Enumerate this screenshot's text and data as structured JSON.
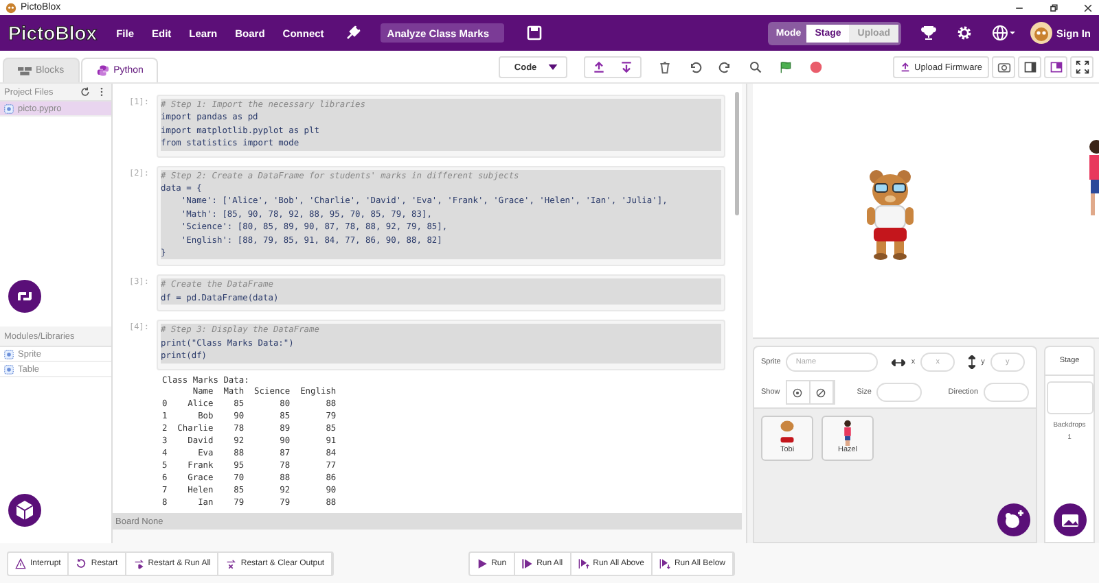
{
  "window": {
    "title": "PictoBlox"
  },
  "menubar": {
    "logo": "PictoBlox",
    "menus": [
      "File",
      "Edit",
      "Learn",
      "Board",
      "Connect"
    ],
    "project_name": "Analyze Class Marks",
    "mode_label": "Mode",
    "modes": [
      {
        "label": "Stage",
        "selected": true
      },
      {
        "label": "Upload",
        "selected": false
      }
    ],
    "sign_in": "Sign In"
  },
  "editor_tabs": [
    {
      "label": "Blocks",
      "kind": "blocks",
      "selected": false
    },
    {
      "label": "Python",
      "kind": "python",
      "selected": true
    }
  ],
  "toolbar": {
    "code_dropdown": "Code",
    "upload_firmware": "Upload Firmware"
  },
  "project_files": {
    "title": "Project Files",
    "files": [
      {
        "name": "picto.pypro",
        "selected": true
      }
    ]
  },
  "modules": {
    "title": "Modules/Libraries",
    "items": [
      "Sprite",
      "Table"
    ]
  },
  "cells": [
    {
      "prompt": "[1]:",
      "lines": [
        {
          "kind": "comment",
          "text": "# Step 1: Import the necessary libraries"
        },
        {
          "kind": "code",
          "text": "import pandas as pd"
        },
        {
          "kind": "code",
          "text": "import matplotlib.pyplot as plt"
        },
        {
          "kind": "code",
          "text": "from statistics import mode"
        }
      ]
    },
    {
      "prompt": "[2]:",
      "lines": [
        {
          "kind": "comment",
          "text": "# Step 2: Create a DataFrame for students' marks in different subjects"
        },
        {
          "kind": "code",
          "text": "data = {"
        },
        {
          "kind": "code",
          "text": "    'Name': ['Alice', 'Bob', 'Charlie', 'David', 'Eva', 'Frank', 'Grace', 'Helen', 'Ian', 'Julia'],"
        },
        {
          "kind": "code",
          "text": "    'Math': [85, 90, 78, 92, 88, 95, 70, 85, 79, 83],"
        },
        {
          "kind": "code",
          "text": "    'Science': [80, 85, 89, 90, 87, 78, 88, 92, 79, 85],"
        },
        {
          "kind": "code",
          "text": "    'English': [88, 79, 85, 91, 84, 77, 86, 90, 88, 82]"
        },
        {
          "kind": "code",
          "text": "}"
        }
      ]
    },
    {
      "prompt": "[3]:",
      "lines": [
        {
          "kind": "comment",
          "text": "# Create the DataFrame"
        },
        {
          "kind": "code",
          "text": "df = pd.DataFrame(data)"
        }
      ]
    },
    {
      "prompt": "[4]:",
      "lines": [
        {
          "kind": "comment",
          "text": "# Step 3: Display the DataFrame"
        },
        {
          "kind": "code",
          "text": "print(\"Class Marks Data:\")"
        },
        {
          "kind": "code",
          "text": "print(df)"
        }
      ]
    }
  ],
  "output": [
    "Class Marks Data:",
    "      Name  Math  Science  English",
    "0    Alice    85       80       88",
    "1      Bob    90       85       79",
    "2  Charlie    78       89       85",
    "3    David    92       90       91",
    "4      Eva    88       87       84",
    "5    Frank    95       78       77",
    "6    Grace    70       88       86",
    "7    Helen    85       92       90",
    "8      Ian    79       79       88"
  ],
  "board_status": "Board None",
  "sprite_panel": {
    "sprite_label": "Sprite",
    "name_placeholder": "Name",
    "x_label": "x",
    "x_placeholder": "x",
    "y_label": "y",
    "y_placeholder": "y",
    "show_label": "Show",
    "size_label": "Size",
    "direction_label": "Direction",
    "sprites": [
      {
        "name": "Tobi",
        "kind": "bear"
      },
      {
        "name": "Hazel",
        "kind": "girl"
      }
    ]
  },
  "stage_panel": {
    "title": "Stage",
    "backdrops_label": "Backdrops",
    "backdrops_count": "1"
  },
  "bottom_left": [
    {
      "label": "Interrupt",
      "kind": "interrupt"
    },
    {
      "label": "Restart",
      "kind": "restart"
    },
    {
      "label": "Restart & Run All",
      "kind": "restart-run"
    },
    {
      "label": "Restart & Clear Output",
      "kind": "restart-clear"
    }
  ],
  "bottom_right": [
    {
      "label": "Run",
      "kind": "run"
    },
    {
      "label": "Run All",
      "kind": "run-all"
    },
    {
      "label": "Run All Above",
      "kind": "run-above"
    },
    {
      "label": "Run All Below",
      "kind": "run-below"
    }
  ]
}
